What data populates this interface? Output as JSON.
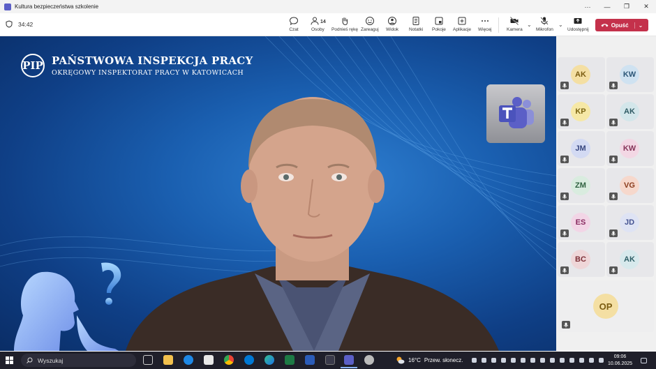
{
  "window": {
    "title": "Kultura bezpieczeństwa szkolenie",
    "controls": [
      "···",
      "—",
      "❐",
      "✕"
    ]
  },
  "toolbar": {
    "timer": "34:42",
    "buttons": [
      {
        "label": "Czat",
        "icon": "chat-icon"
      },
      {
        "label": "Osoby",
        "icon": "people-icon",
        "count": "14"
      },
      {
        "label": "Podnieś rękę",
        "icon": "raise-hand-icon"
      },
      {
        "label": "Zareaguj",
        "icon": "smile-icon"
      },
      {
        "label": "Widok",
        "icon": "view-icon"
      },
      {
        "label": "Notatki",
        "icon": "notes-icon"
      },
      {
        "label": "Pokoje",
        "icon": "rooms-icon"
      },
      {
        "label": "Aplikacje",
        "icon": "apps-icon"
      },
      {
        "label": "Więcej",
        "icon": "more-icon"
      },
      {
        "label": "Kamera",
        "icon": "camera-off-icon"
      },
      {
        "label": "Mikrofon",
        "icon": "mic-off-icon"
      },
      {
        "label": "Udostępnij",
        "icon": "share-icon"
      }
    ],
    "leave_label": "Opuść"
  },
  "stage": {
    "org_name": "PAŃSTWOWA INSPEKCJA PRACY",
    "org_sub": "OKRĘGOWY INSPEKTORAT PRACY W KATOWICACH",
    "colors": {
      "bg": "#1a5fb0",
      "accent": "#8fd0ff"
    }
  },
  "participants": [
    {
      "initials": "AK",
      "bg": "#f4dfa3",
      "fg": "#7a5b10"
    },
    {
      "initials": "KW",
      "bg": "#cfe2f1",
      "fg": "#2b5576"
    },
    {
      "initials": "KP",
      "bg": "#f6e8a6",
      "fg": "#7b6513"
    },
    {
      "initials": "AK",
      "bg": "#d3e6ea",
      "fg": "#2e5a63"
    },
    {
      "initials": "JM",
      "bg": "#d3daf3",
      "fg": "#37467f"
    },
    {
      "initials": "KW",
      "bg": "#f3d7e4",
      "fg": "#853358"
    },
    {
      "initials": "ZM",
      "bg": "#d9ecdf",
      "fg": "#2f6240"
    },
    {
      "initials": "VG",
      "bg": "#f6d8cc",
      "fg": "#8a3b1c"
    },
    {
      "initials": "ES",
      "bg": "#f2d5e6",
      "fg": "#8a2d62"
    },
    {
      "initials": "JD",
      "bg": "#dee3f4",
      "fg": "#445291"
    },
    {
      "initials": "BC",
      "bg": "#efd6d8",
      "fg": "#7d2e36"
    },
    {
      "initials": "AK",
      "bg": "#d7e9ec",
      "fg": "#2e5e66"
    }
  ],
  "spotlight": {
    "initials": "OP"
  },
  "taskbar": {
    "search_placeholder": "Wyszukaj",
    "weather_temp": "16°C",
    "weather_text": "Przew. słonecz.",
    "time": "09:06",
    "date": "10.06.2025"
  }
}
